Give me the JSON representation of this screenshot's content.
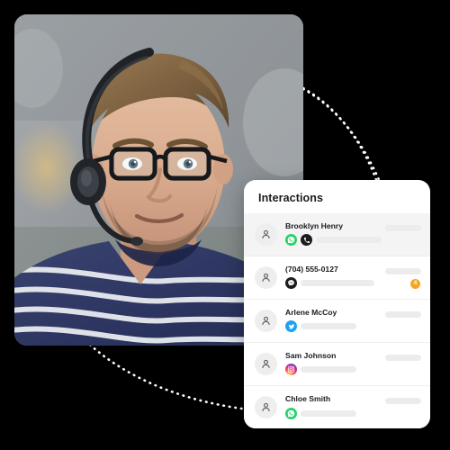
{
  "card": {
    "title": "Interactions",
    "rows": [
      {
        "name": "Brooklyn Henry",
        "channels": [
          "whatsapp-icon",
          "call-icon"
        ],
        "badge": "",
        "selected": true
      },
      {
        "name": "(704) 555-0127",
        "channels": [
          "chat-icon"
        ],
        "badge": "4",
        "selected": false
      },
      {
        "name": "Arlene McCoy",
        "channels": [
          "twitter-icon"
        ],
        "badge": "",
        "selected": false
      },
      {
        "name": "Sam Johnson",
        "channels": [
          "instagram-icon"
        ],
        "badge": "",
        "selected": false
      },
      {
        "name": "Chloe Smith",
        "channels": [
          "whatsapp-icon"
        ],
        "badge": "",
        "selected": false
      }
    ]
  },
  "colors": {
    "badge": "#F5A623",
    "whatsapp": "#25D366",
    "twitter": "#1DA1F2",
    "dark": "#1D1D1F",
    "skeleton": "#ECECED",
    "card_bg": "#FFFFFF",
    "row_selected": "#F4F4F5",
    "background": "#000000"
  },
  "photo": {
    "alt": "support agent wearing headset and glasses"
  }
}
